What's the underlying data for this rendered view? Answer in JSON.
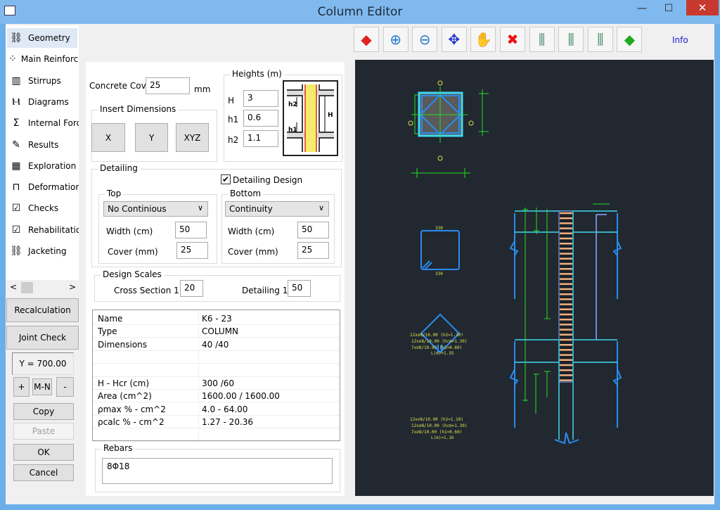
{
  "window": {
    "title": "Column Editor",
    "minimize": "—",
    "maximize": "☐",
    "close": "✕"
  },
  "sidebar": {
    "items": [
      {
        "label": "Geometry",
        "icon": "geometry-icon"
      },
      {
        "label": "Main Reinforcement",
        "icon": "main-reinforcement-icon"
      },
      {
        "label": "Stirrups",
        "icon": "stirrups-icon"
      },
      {
        "label": "Diagrams",
        "icon": "diagrams-icon"
      },
      {
        "label": "Internal Forces",
        "icon": "internal-forces-icon"
      },
      {
        "label": "Results",
        "icon": "results-icon"
      },
      {
        "label": "Exploration",
        "icon": "exploration-icon"
      },
      {
        "label": "Deformations",
        "icon": "deformations-icon"
      },
      {
        "label": "Checks",
        "icon": "checks-icon"
      },
      {
        "label": "Rehabilitation",
        "icon": "rehabilitation-icon"
      },
      {
        "label": "Jacketing",
        "icon": "jacketing-icon"
      }
    ],
    "scroll_left": "<",
    "scroll_right": ">"
  },
  "left_buttons": {
    "recalculation": "Recalculation",
    "joint_check": "Joint Check",
    "y_value": "Y = 700.00",
    "plus": "+",
    "mn": "M-N",
    "minus": "-",
    "copy": "Copy",
    "paste": "Paste",
    "ok": "OK",
    "cancel": "Cancel"
  },
  "toolbar": {
    "tools": [
      "3d-view",
      "zoom-in",
      "zoom-out",
      "zoom-extents",
      "pan",
      "delete",
      "rebar-view-1",
      "rebar-view-2",
      "rebar-view-3",
      "3d-shapes"
    ],
    "info": "Info"
  },
  "geometry": {
    "concrete_cover_label": "Concrete Cover",
    "concrete_cover": "25",
    "cover_unit": "mm",
    "insert_dimensions": {
      "title": "Insert Dimensions",
      "x": "X",
      "y": "Y",
      "xyz": "XYZ"
    },
    "heights": {
      "title": "Heights (m)",
      "H_label": "H",
      "H": "3",
      "h1_label": "h1",
      "h1": "0.6",
      "h2_label": "h2",
      "h2": "1.1",
      "diagram_h2": "h2",
      "diagram_h1": "h1",
      "diagram_H": "H"
    },
    "detailing": {
      "title": "Detailing",
      "design_label": "Detailing Design",
      "design_checked": true,
      "top": {
        "title": "Top",
        "select": "No Continious",
        "width_label": "Width (cm)",
        "width": "50",
        "cover_label": "Cover (mm)",
        "cover": "25"
      },
      "bottom": {
        "title": "Bottom",
        "select": "Continuity",
        "width_label": "Width (cm)",
        "width": "50",
        "cover_label": "Cover (mm)",
        "cover": "25"
      }
    },
    "scales": {
      "title": "Design Scales",
      "cross_label": "Cross Section 1:",
      "cross": "20",
      "detailing_label": "Detailing 1:",
      "detailing": "50"
    }
  },
  "properties": {
    "rows": [
      {
        "k": "Name",
        "v": "K6 - 23"
      },
      {
        "k": "Type",
        "v": "COLUMN"
      },
      {
        "k": "Dimensions",
        "v": "40   /40"
      },
      {
        "k": "",
        "v": ""
      },
      {
        "k": "",
        "v": ""
      },
      {
        "k": "H - Hcr (cm)",
        "v": "300  /60"
      },
      {
        "k": "Area (cm^2)",
        "v": "1600.00 / 1600.00"
      },
      {
        "k": "ρmax % - cm^2",
        "v": "4.0 - 64.00"
      },
      {
        "k": "ρcalc % - cm^2",
        "v": "1.27 - 20.36"
      },
      {
        "k": "",
        "v": ""
      }
    ]
  },
  "rebars": {
    "title": "Rebars",
    "value": "8Φ18"
  },
  "colors": {
    "cad_bg": "#212830",
    "cad_green": "#22e022",
    "cad_blue": "#2a8cf0",
    "cad_cyan": "#40d8f0",
    "cad_yellow": "#e0e050",
    "stirrup": "#f0b080"
  }
}
